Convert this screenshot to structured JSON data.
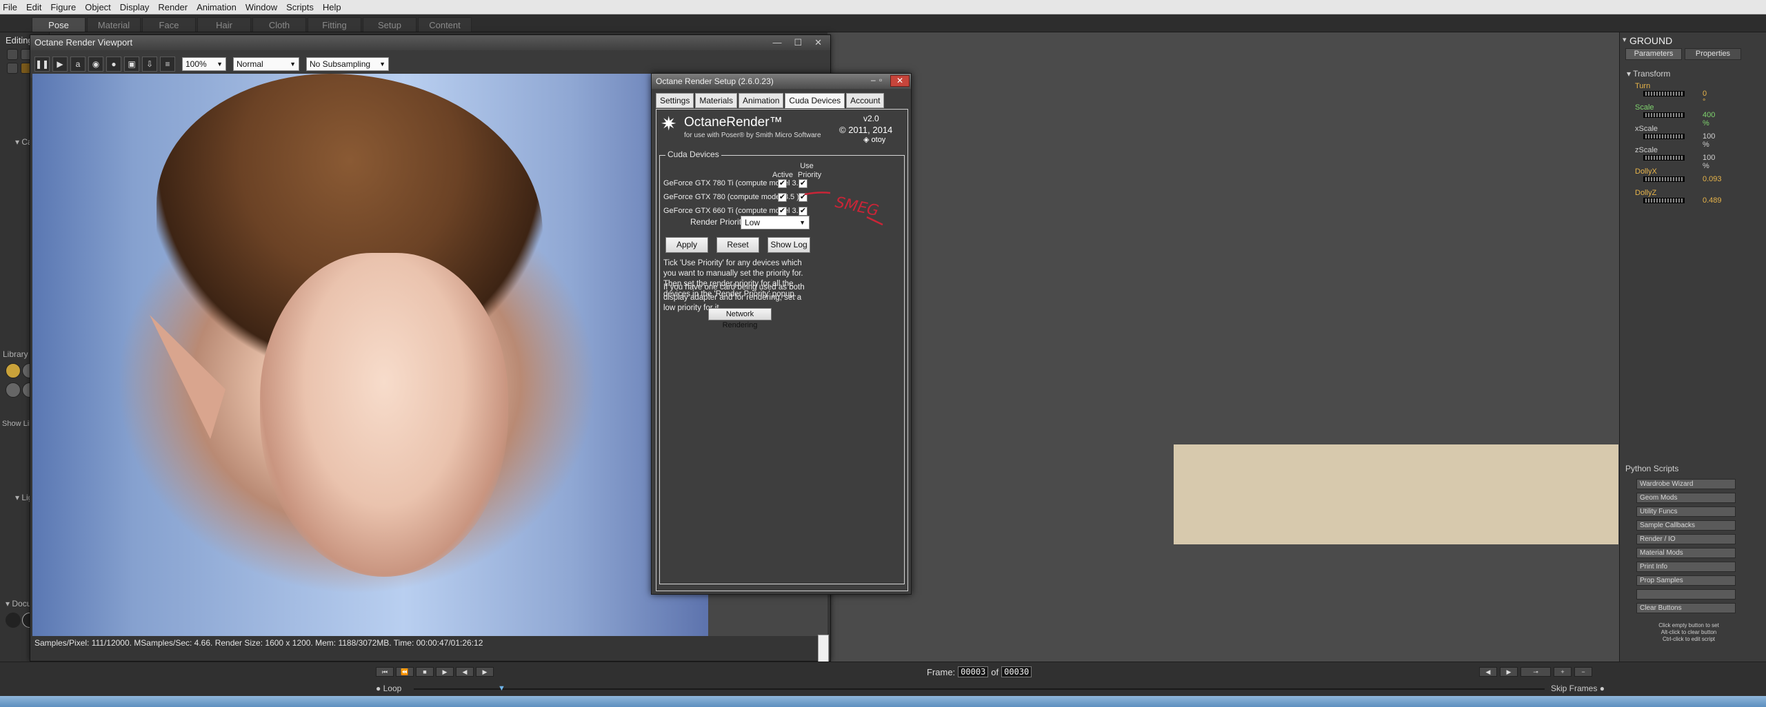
{
  "menu": [
    "File",
    "Edit",
    "Figure",
    "Object",
    "Display",
    "Render",
    "Animation",
    "Window",
    "Scripts",
    "Help"
  ],
  "rooms": [
    "Pose",
    "Material",
    "Face",
    "Hair",
    "Cloth",
    "Fitting",
    "Setup",
    "Content"
  ],
  "left_panel": {
    "editing_tools": "Editing To",
    "camera": "Ca",
    "library": "Library",
    "show_library": "Show Library",
    "lights": "Lig",
    "document": "Docu"
  },
  "viewport": {
    "title": "Octane Render Viewport",
    "zoom": "100%",
    "mode": "Normal",
    "subsampling": "No Subsampling",
    "status": "Samples/Pixel: 111/12000. MSamples/Sec: 4.66. Render Size: 1600 x 1200. Mem: 1188/3072MB. Time: 00:00:47/01:26:12"
  },
  "octane_setup": {
    "title": "Octane Render Setup (2.6.0.23)",
    "tabs": [
      "Settings",
      "Materials",
      "Animation",
      "Cuda Devices",
      "Account"
    ],
    "active_tab": "Cuda Devices",
    "logo_text": "OctaneRender™",
    "logo_sub": "for use with Poser® by Smith Micro Software",
    "version": "v2.0",
    "copyright": "© 2011, 2014",
    "brand": "otoy",
    "group_title": "Cuda Devices",
    "col_active": "Active",
    "col_use": "Use",
    "col_priority": "Priority",
    "devices": [
      {
        "name": "GeForce GTX 780 Ti (compute model 3.5 )",
        "active": "✔",
        "priority": "✔"
      },
      {
        "name": "GeForce GTX 780 (compute model 3.5 )",
        "active": "✔",
        "priority": "✔"
      },
      {
        "name": "GeForce GTX 660 Ti (compute model 3.0 )",
        "active": "✔",
        "priority": "✔"
      }
    ],
    "render_priority_label": "Render Priority",
    "render_priority_value": "Low",
    "apply": "Apply",
    "reset": "Reset",
    "show_log": "Show Log",
    "help1": "Tick 'Use Priority' for any devices which you want to manually set the priority for.  Then set the render priority for all the devices in the 'Render Priority' popup.",
    "help2": "If you have one card being used as both display adapter and for rendering, set a low priority for it.",
    "network_rendering": "Network Rendering",
    "annotation": "SMEG"
  },
  "properties": {
    "title": "GROUND",
    "tabs": [
      "Parameters",
      "Properties"
    ],
    "transform": "Transform",
    "params": [
      {
        "label": "Turn",
        "value": "0 °",
        "color": "#e6b34a"
      },
      {
        "label": "Scale",
        "value": "400 %",
        "color": "#7fd36e"
      },
      {
        "label": "xScale",
        "value": "100 %",
        "color": "#d0d0d0"
      },
      {
        "label": "zScale",
        "value": "100 %",
        "color": "#d0d0d0"
      },
      {
        "label": "DollyX",
        "value": "0.093",
        "color": "#e6b34a"
      },
      {
        "label": "DollyZ",
        "value": "0.489",
        "color": "#e6b34a"
      }
    ],
    "python_scripts": "Python Scripts",
    "scripts": [
      "Wardrobe Wizard",
      "Geom Mods",
      "Utility Funcs",
      "Sample Callbacks",
      "Render / IO",
      "Material Mods",
      "Print Info",
      "Prop Samples",
      "",
      "Clear Buttons"
    ],
    "notes": [
      "Click empty button to set",
      "Alt-click to clear button",
      "Ctrl-click to edit script"
    ]
  },
  "bottom": {
    "frame_label": "Frame:",
    "frame": "00003",
    "of": "of",
    "total": "00030",
    "loop": "Loop",
    "skip_frames": "Skip Frames"
  }
}
